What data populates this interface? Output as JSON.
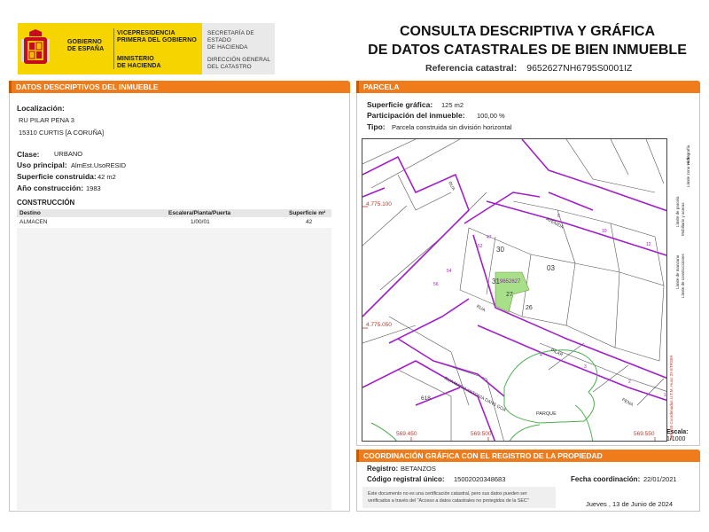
{
  "header": {
    "gov_line1": "GOBIERNO",
    "gov_line2": "DE ESPAÑA",
    "vice_line1": "VICEPRESIDENCIA",
    "vice_line2": "PRIMERA DEL GOBIERNO",
    "min_line1": "MINISTERIO",
    "min_line2": "DE HACIENDA",
    "sec_line1": "SECRETARÍA DE ESTADO",
    "sec_line2": "DE HACIENDA",
    "dir_line1": "DIRECCIÓN GENERAL",
    "dir_line2": "DEL CATASTRO",
    "title_line1": "CONSULTA DESCRIPTIVA Y GRÁFICA",
    "title_line2": "DE DATOS CATASTRALES DE BIEN INMUEBLE",
    "ref_label": "Referencia catastral:",
    "ref_value": "9652627NH6795S0001IZ"
  },
  "left": {
    "section_title": "DATOS DESCRIPTIVOS DEL INMUEBLE",
    "loc_label": "Localización:",
    "loc_line1": "RU PILAR PENA 3",
    "loc_line2": "15310 CURTIS [A CORUÑA]",
    "clase_label": "Clase:",
    "clase_value": "URBANO",
    "uso_label": "Uso principal:",
    "uso_value": "AlmEst.UsoRESID",
    "sup_label": "Superficie construida:",
    "sup_value": "42 m2",
    "anio_label": "Año construcción:",
    "anio_value": "1983",
    "constr_title": "CONSTRUCCIÓN",
    "table": {
      "headers": [
        "Destino",
        "Escalera/Planta/Puerta",
        "Superficie m²"
      ],
      "rows": [
        [
          "ALMACEN",
          "1/00/01",
          "42"
        ]
      ]
    }
  },
  "right": {
    "section_title": "PARCELA",
    "sg_label": "Superficie gráfica:",
    "sg_value": "125 m2",
    "part_label": "Participación del inmueble:",
    "part_value": "100,00 %",
    "tipo_label": "Tipo:",
    "tipo_value": "Parcela construida sin división horizontal",
    "map_labels": {
      "y1": "4.775.100",
      "y2": "4.775.050",
      "x1": "569.450",
      "x2": "569.500",
      "x3": "569.550",
      "p03": "03",
      "p30": "30",
      "p31": "31",
      "p27": "27",
      "p26": "26",
      "p52": "9652627",
      "p618": "618",
      "parque": "PARQUE",
      "street1": "AVENIDA",
      "street2": "PILAR",
      "street3": "PENA",
      "street4": "RUA MARIA ANTONIA DANS GOA",
      "street5": "RUA",
      "street6": "RUA"
    },
    "legend_texts": [
      "Límite de manzana",
      "Límite de parcela",
      "Límite de construcciones",
      "Mobiliario y aceras",
      "Límite zona verde",
      "Hidrografía"
    ],
    "legend_note": "569.550 Coordenadas U.T.M. Huso 29 ETRS89",
    "escala_label": "Escala:",
    "escala_value": "1/1000"
  },
  "coord": {
    "section_title": "COORDINACIÓN GRÁFICA CON EL REGISTRO DE LA PROPIEDAD",
    "reg_label": "Registro:",
    "reg_value": "BETANZOS",
    "cru_label": "Código registral único:",
    "cru_value": "15002020348683",
    "fecha_label": "Fecha coordinación:",
    "fecha_value": "22/01/2021",
    "note_line1": "Este documento no es una certificación catastral, pero sus datos pueden ser",
    "note_line2": "verificados a través del \"Acceso a datos catastrales no protegidos de la SEC\"",
    "date": "Jueves , 13 de Junio de 2024"
  },
  "colors": {
    "brand_yellow": "#f5d400",
    "section_orange": "#f07b1b",
    "parcel_purple": "#a020c8",
    "parcel_green": "#a8e08a",
    "red_coord": "#c0392b"
  }
}
